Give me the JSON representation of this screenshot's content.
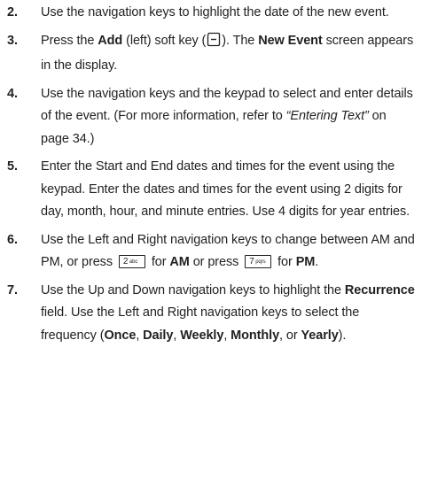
{
  "steps": [
    {
      "number": "2.",
      "text": "Use the navigation keys to highlight the date of the new event."
    },
    {
      "number": "3.",
      "t1": "Press the ",
      "add": "Add",
      "t2": " (left) soft key (",
      "softkey_icon": "left-softkey-icon",
      "t3": "). The ",
      "new_event": "New Event",
      "t4": " screen appears in the display."
    },
    {
      "number": "4.",
      "t1": "Use the navigation keys and the keypad to select and enter details of the event. (For more information, refer to ",
      "ref": "“Entering Text”",
      "t2": " on page 34.)"
    },
    {
      "number": "5.",
      "text": "Enter the Start and End dates and times for the event using the keypad. Enter the dates and times for the event using 2 digits for day, month, hour, and minute entries. Use 4 digits for year entries."
    },
    {
      "number": "6.",
      "t1": "Use the Left and Right navigation keys to change between AM and PM, or press ",
      "key_2_digit": "2",
      "key_2_letters": "abc",
      "t2": " for ",
      "am": "AM",
      "t3": " or press ",
      "key_7_digit": "7",
      "key_7_letters": "pqrs",
      "t4": " for ",
      "pm": "PM",
      "t5": "."
    },
    {
      "number": "7.",
      "t1": "Use the Up and Down navigation keys to highlight the ",
      "recurrence": "Recurrence",
      "t2": " field. Use the Left and Right navigation keys to select the frequency (",
      "once": "Once",
      "c1": ", ",
      "daily": "Daily",
      "c2": ", ",
      "weekly": "Weekly",
      "c3": ", ",
      "monthly": "Monthly",
      "c4": ", or ",
      "yearly": "Yearly",
      "t3": ")."
    }
  ]
}
